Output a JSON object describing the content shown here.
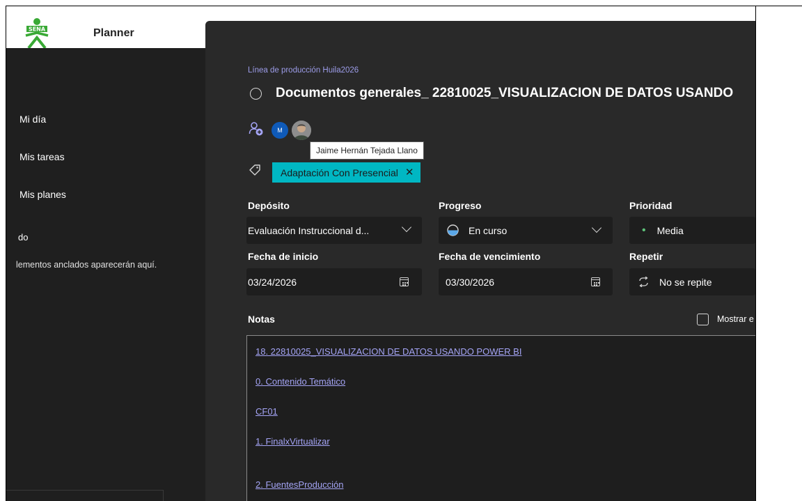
{
  "app": {
    "title": "Planner"
  },
  "sidebar": {
    "items": [
      {
        "label": "Mi día"
      },
      {
        "label": "Mis tareas"
      },
      {
        "label": "Mis planes"
      }
    ],
    "pinned_heading": "do",
    "pinned_empty": "lementos anclados aparecerán aquí."
  },
  "task": {
    "plan_name": "Línea de producción Huila2026",
    "title": "Documentos generales_ 22810025_VISUALIZACION DE DATOS USANDO",
    "assignees": [
      {
        "initials": "M"
      },
      {
        "name": "Jaime Hernán Tejada Llano"
      }
    ],
    "tooltip": "Jaime Hernán Tejada Llano",
    "label_chip": {
      "text": "Adaptación Con Presencial",
      "remove": "✕",
      "color": "#00b7c3"
    },
    "bucket": {
      "label": "Depósito",
      "value": "Evaluación Instruccional d..."
    },
    "progress": {
      "label": "Progreso",
      "value": "En curso"
    },
    "priority": {
      "label": "Prioridad",
      "value": "Media",
      "bullet": "•"
    },
    "start_date": {
      "label": "Fecha de inicio",
      "value": "03/24/2026"
    },
    "due_date": {
      "label": "Fecha de vencimiento",
      "value": "03/30/2026"
    },
    "repeat": {
      "label": "Repetir",
      "value": "No se repite"
    },
    "notes": {
      "label": "Notas",
      "show_on_card": "Mostrar e",
      "links": [
        "18. 22810025_VISUALIZACION DE DATOS USANDO POWER BI",
        "0. Contenido Temático",
        "CF01",
        "1. FinalxVirtualizar",
        "2. FuentesProducción"
      ]
    }
  },
  "colors": {
    "sidebar_bg": "#1f1f1f",
    "panel_bg": "#292929",
    "field_bg": "#1e1e1e",
    "accent_link": "#a4a4f5",
    "logo_green": "#39a935"
  }
}
